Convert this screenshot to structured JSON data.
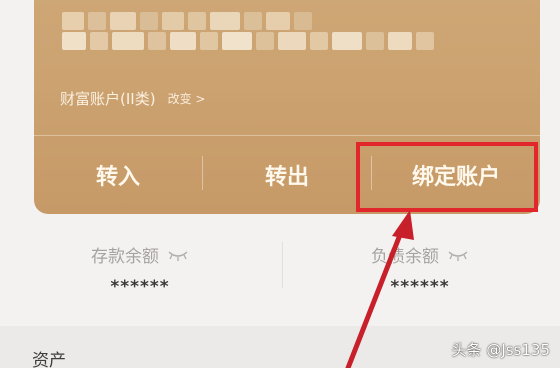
{
  "card": {
    "account_type": "财富账户(II类)",
    "change_link": "改变 >",
    "actions": [
      "转入",
      "转出",
      "绑定账户"
    ]
  },
  "balances": {
    "deposit_label": "存款余额",
    "deposit_value": "******",
    "debt_label": "负债余额",
    "debt_value": "******"
  },
  "section": {
    "assets_title": "资产"
  },
  "watermark": "头条 @Jss135",
  "colors": {
    "card": "#c9a06e",
    "highlight": "#e1262c",
    "arrow": "#c8202a"
  }
}
